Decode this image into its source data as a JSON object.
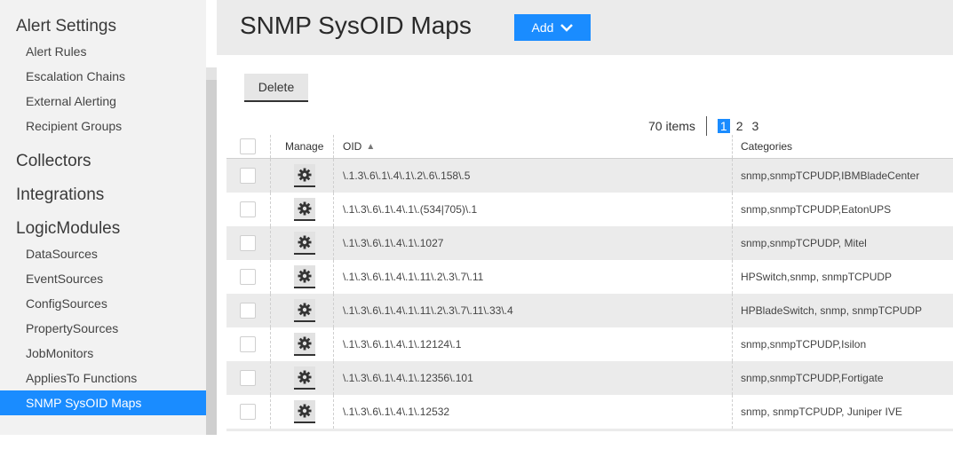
{
  "sidebar": {
    "sections": [
      {
        "title": "Alert Settings",
        "items": [
          "Alert Rules",
          "Escalation Chains",
          "External Alerting",
          "Recipient Groups"
        ]
      },
      {
        "title": "Collectors",
        "items": []
      },
      {
        "title": "Integrations",
        "items": []
      },
      {
        "title": "LogicModules",
        "items": [
          "DataSources",
          "EventSources",
          "ConfigSources",
          "PropertySources",
          "JobMonitors",
          "AppliesTo Functions",
          "SNMP SysOID Maps"
        ]
      }
    ],
    "active_item": "SNMP SysOID Maps",
    "accent": "#1a8cff"
  },
  "header": {
    "title": "SNMP SysOID Maps",
    "add_label": "Add",
    "collapse_glyph": "❮"
  },
  "toolbar": {
    "delete_label": "Delete"
  },
  "pager": {
    "count_label": "70 items",
    "pages": [
      "1",
      "2",
      "3"
    ],
    "current": "1"
  },
  "table": {
    "columns": {
      "manage": "Manage",
      "oid": "OID",
      "categories": "Categories"
    },
    "sort_icon": "▲",
    "rows": [
      {
        "oid": "\\.1.3\\.6\\.1\\.4\\.1\\.2\\.6\\.158\\.5",
        "categories": "snmp,snmpTCPUDP,IBMBladeCenter"
      },
      {
        "oid": "\\.1\\.3\\.6\\.1\\.4\\.1\\.(534|705)\\.1",
        "categories": "snmp,snmpTCPUDP,EatonUPS"
      },
      {
        "oid": "\\.1\\.3\\.6\\.1\\.4\\.1\\.1027",
        "categories": "snmp,snmpTCPUDP, Mitel"
      },
      {
        "oid": "\\.1\\.3\\.6\\.1\\.4\\.1\\.11\\.2\\.3\\.7\\.11",
        "categories": "HPSwitch,snmp, snmpTCPUDP"
      },
      {
        "oid": "\\.1\\.3\\.6\\.1\\.4\\.1\\.11\\.2\\.3\\.7\\.11\\.33\\.4",
        "categories": "HPBladeSwitch, snmp, snmpTCPUDP"
      },
      {
        "oid": "\\.1\\.3\\.6\\.1\\.4\\.1\\.12124\\.1",
        "categories": "snmp,snmpTCPUDP,Isilon"
      },
      {
        "oid": "\\.1\\.3\\.6\\.1\\.4\\.1\\.12356\\.101",
        "categories": "snmp,snmpTCPUDP,Fortigate"
      },
      {
        "oid": "\\.1\\.3\\.6\\.1\\.4\\.1\\.12532",
        "categories": "snmp, snmpTCPUDP, Juniper IVE"
      }
    ]
  }
}
